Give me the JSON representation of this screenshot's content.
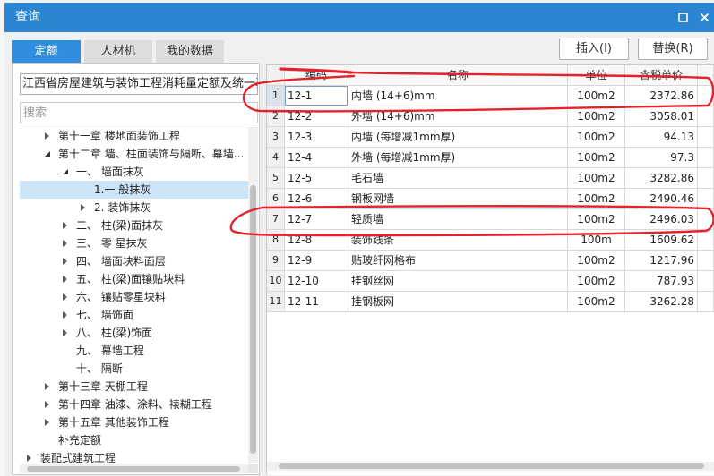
{
  "window": {
    "title": "查询",
    "icons": {
      "maximize": "maximize-icon",
      "close": "close-icon"
    }
  },
  "colors": {
    "title_bar": "#2a86d2",
    "active_tab": "#2f8ee0",
    "selection": "#cde4f7",
    "annotation": "#e3232b"
  },
  "tabs": [
    {
      "label": "定额",
      "active": true
    },
    {
      "label": "人材机",
      "active": false
    },
    {
      "label": "我的数据",
      "active": false
    }
  ],
  "actions": {
    "insert_label": "插入(I)",
    "replace_label": "替换(R)"
  },
  "library_select": {
    "value": "江西省房屋建筑与装饰工程消耗量定额及统一基"
  },
  "search": {
    "placeholder": "搜索"
  },
  "tree": [
    {
      "depth": 1,
      "has_children": true,
      "expanded": false,
      "label": "第十一章 楼地面装饰工程"
    },
    {
      "depth": 1,
      "has_children": true,
      "expanded": true,
      "label": "第十二章 墙、柱面装饰与隔断、幕墙..."
    },
    {
      "depth": 2,
      "has_children": true,
      "expanded": true,
      "label": "一、 墙面抹灰"
    },
    {
      "depth": 3,
      "has_children": false,
      "expanded": false,
      "label": "1.一 般抹灰",
      "selected": true
    },
    {
      "depth": 3,
      "has_children": true,
      "expanded": false,
      "label": "2. 装饰抹灰"
    },
    {
      "depth": 2,
      "has_children": true,
      "expanded": false,
      "label": "二、 柱(梁)面抹灰"
    },
    {
      "depth": 2,
      "has_children": true,
      "expanded": false,
      "label": "三、 零 星抹灰"
    },
    {
      "depth": 2,
      "has_children": true,
      "expanded": false,
      "label": "四、 墙面块料面层"
    },
    {
      "depth": 2,
      "has_children": true,
      "expanded": false,
      "label": "五、 柱(梁)面镶贴块料"
    },
    {
      "depth": 2,
      "has_children": true,
      "expanded": false,
      "label": "六、 镶贴零星块料"
    },
    {
      "depth": 2,
      "has_children": true,
      "expanded": false,
      "label": "七、 墙饰面"
    },
    {
      "depth": 2,
      "has_children": true,
      "expanded": false,
      "label": "八、 柱(梁)饰面"
    },
    {
      "depth": 2,
      "has_children": false,
      "expanded": false,
      "label": "九、 幕墙工程"
    },
    {
      "depth": 2,
      "has_children": false,
      "expanded": false,
      "label": "十、 隔断"
    },
    {
      "depth": 1,
      "has_children": true,
      "expanded": false,
      "label": "第十三章 天棚工程"
    },
    {
      "depth": 1,
      "has_children": true,
      "expanded": false,
      "label": "第十四章 油漆、涂料、裱糊工程"
    },
    {
      "depth": 1,
      "has_children": true,
      "expanded": false,
      "label": "第十五章 其他装饰工程"
    },
    {
      "depth": 1,
      "has_children": false,
      "expanded": false,
      "label": "补充定额"
    },
    {
      "depth": 0,
      "has_children": true,
      "expanded": false,
      "label": "装配式建筑工程"
    }
  ],
  "table": {
    "headers": {
      "code": "编码",
      "name": "名称",
      "unit": "单位",
      "price": "含税单价"
    },
    "rows": [
      {
        "no": "1",
        "code": "12-1",
        "name": "内墙 (14+6)mm",
        "unit": "100m2",
        "price": "2372.86",
        "selected": true
      },
      {
        "no": "2",
        "code": "12-2",
        "name": "外墙 (14+6)mm",
        "unit": "100m2",
        "price": "3058.01"
      },
      {
        "no": "3",
        "code": "12-3",
        "name": "内墙 (每增减1mm厚)",
        "unit": "100m2",
        "price": "94.13"
      },
      {
        "no": "4",
        "code": "12-4",
        "name": "外墙 (每增减1mm厚)",
        "unit": "100m2",
        "price": "97.3"
      },
      {
        "no": "5",
        "code": "12-5",
        "name": "毛石墙",
        "unit": "100m2",
        "price": "3282.86"
      },
      {
        "no": "6",
        "code": "12-6",
        "name": "钢板网墙",
        "unit": "100m2",
        "price": "2490.46"
      },
      {
        "no": "7",
        "code": "12-7",
        "name": "轻质墙",
        "unit": "100m2",
        "price": "2496.03"
      },
      {
        "no": "8",
        "code": "12-8",
        "name": "装饰线条",
        "unit": "100m",
        "price": "1609.62"
      },
      {
        "no": "9",
        "code": "12-9",
        "name": "贴玻纤网格布",
        "unit": "100m2",
        "price": "1217.96"
      },
      {
        "no": "10",
        "code": "12-10",
        "name": "挂钢丝网",
        "unit": "100m2",
        "price": "787.93"
      },
      {
        "no": "11",
        "code": "12-11",
        "name": "挂钢板网",
        "unit": "100m2",
        "price": "3262.28"
      }
    ]
  }
}
